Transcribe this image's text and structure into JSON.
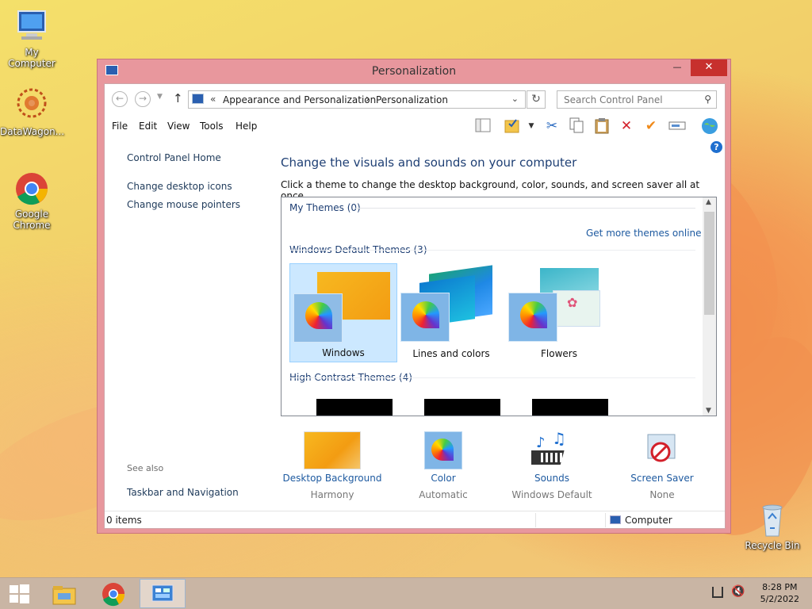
{
  "desktop": {
    "icons": [
      {
        "label": "My Computer"
      },
      {
        "label": "DataWagon..."
      },
      {
        "label": "Google Chrome"
      },
      {
        "label": "Recycle Bin"
      }
    ]
  },
  "window": {
    "title": "Personalization",
    "controls": {
      "minimize": "—",
      "maximize": "☐",
      "close": "✕"
    },
    "address": {
      "prefix": "«",
      "crumbs": [
        "Appearance and Personalization",
        "Personalization"
      ],
      "separator": "›"
    },
    "search": {
      "placeholder": "Search Control Panel"
    },
    "menu": [
      "File",
      "Edit",
      "View",
      "Tools",
      "Help"
    ],
    "help_glyph": "?",
    "left_pane": {
      "home": "Control Panel Home",
      "links": [
        "Change desktop icons",
        "Change mouse pointers"
      ],
      "see_also_label": "See also",
      "see_also_links": [
        "Taskbar and Navigation"
      ]
    },
    "main": {
      "heading": "Change the visuals and sounds on your computer",
      "subtitle": "Click a theme to change the desktop background, color, sounds, and screen saver all at once.",
      "my_themes": "My Themes (0)",
      "get_more": "Get more themes online",
      "default_themes": "Windows Default Themes (3)",
      "themes": [
        {
          "name": "Windows",
          "selected": true
        },
        {
          "name": "Lines and colors",
          "selected": false
        },
        {
          "name": "Flowers",
          "selected": false
        }
      ],
      "high_contrast": "High Contrast Themes (4)"
    },
    "bottom": [
      {
        "title": "Desktop Background",
        "value": "Harmony"
      },
      {
        "title": "Color",
        "value": "Automatic"
      },
      {
        "title": "Sounds",
        "value": "Windows Default"
      },
      {
        "title": "Screen Saver",
        "value": "None"
      }
    ],
    "status": {
      "items": "0 items",
      "location": "Computer"
    }
  },
  "taskbar": {
    "time": "8:28 PM",
    "date": "5/2/2022"
  },
  "colors": {
    "window_frame": "#e8979d",
    "link_blue": "#1e3f74",
    "selection": "#cce8ff"
  }
}
